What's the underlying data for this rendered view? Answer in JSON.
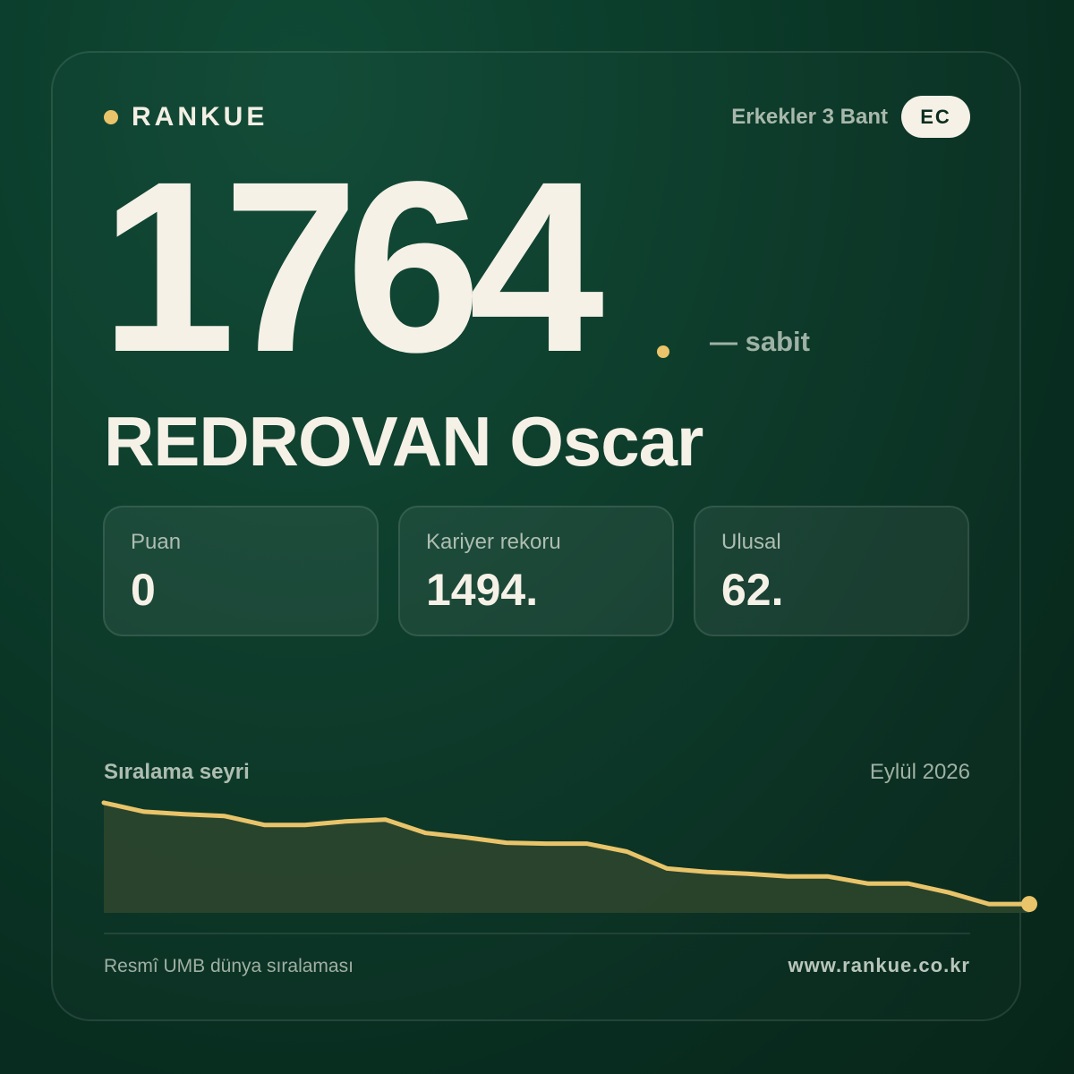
{
  "brand": {
    "name": "RANKUE"
  },
  "header": {
    "division": "Erkekler 3 Bant",
    "country_code": "EC"
  },
  "ranking": {
    "rank": "1764",
    "change_text": "— sabit"
  },
  "player": {
    "name": "REDROVAN Oscar"
  },
  "stats": [
    {
      "label": "Puan",
      "value": "0"
    },
    {
      "label": "Kariyer rekoru",
      "value": "1494."
    },
    {
      "label": "Ulusal",
      "value": "62."
    }
  ],
  "trend": {
    "title": "Sıralama seyri",
    "date": "Eylül 2026"
  },
  "chart_data": {
    "type": "area",
    "title": "Sıralama seyri",
    "xlabel": "",
    "ylabel": "",
    "grid": false,
    "y_axis_shown": false,
    "series": [
      {
        "values": [
          8,
          18,
          21,
          23,
          33,
          33,
          29,
          27,
          42,
          47,
          53,
          54,
          54,
          63,
          82,
          86,
          88,
          91,
          91,
          99,
          99,
          109,
          122,
          122
        ]
      }
    ],
    "ylim": [
      0,
      132
    ],
    "line_color": "#e9c46a",
    "fill_color": "#2b452c"
  },
  "footer": {
    "source": "Resmî UMB dünya sıralaması",
    "website": "www.rankue.co.kr"
  }
}
